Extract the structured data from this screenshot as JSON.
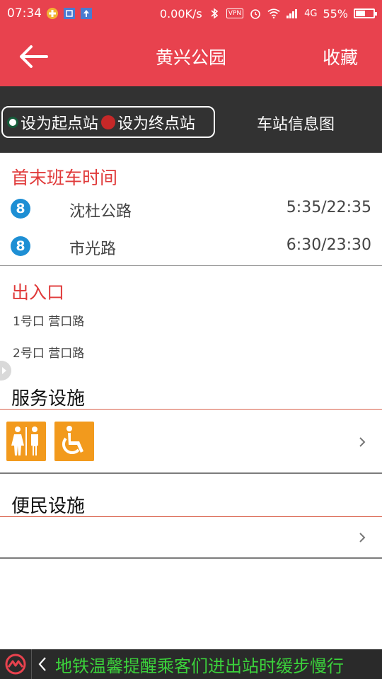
{
  "status_bar": {
    "time": "07:34",
    "net_speed": "0.00K/s",
    "vpn": "VPN",
    "network": "4G",
    "battery": "55%",
    "battery_level": 0.55
  },
  "header": {
    "title": "黄兴公园",
    "favorite_label": "收藏"
  },
  "toolbar": {
    "set_start_label": "设为起点站",
    "set_end_label": "设为终点站",
    "station_map_label": "车站信息图"
  },
  "schedule": {
    "title": "首末班车时间",
    "rows": [
      {
        "line": "8",
        "direction": "沈杜公路",
        "times": "5:35/22:35"
      },
      {
        "line": "8",
        "direction": "市光路",
        "times": "6:30/23:30"
      }
    ]
  },
  "exits": {
    "title": "出入口",
    "items": [
      "1号口 营口路",
      "2号口 营口路"
    ]
  },
  "services": {
    "title": "服务设施",
    "icons": [
      "restroom-icon",
      "wheelchair-icon"
    ]
  },
  "conveniences": {
    "title": "便民设施"
  },
  "marquee": {
    "text": "地铁温馨提醒乘客们进出站时缓步慢行"
  },
  "colors": {
    "header": "#e8424e",
    "toolbar": "#323232",
    "accent_red": "#e03a3a",
    "line_8": "#1e8fd4",
    "facility_orange": "#f29a1d",
    "marquee_text": "#3bd23b"
  }
}
